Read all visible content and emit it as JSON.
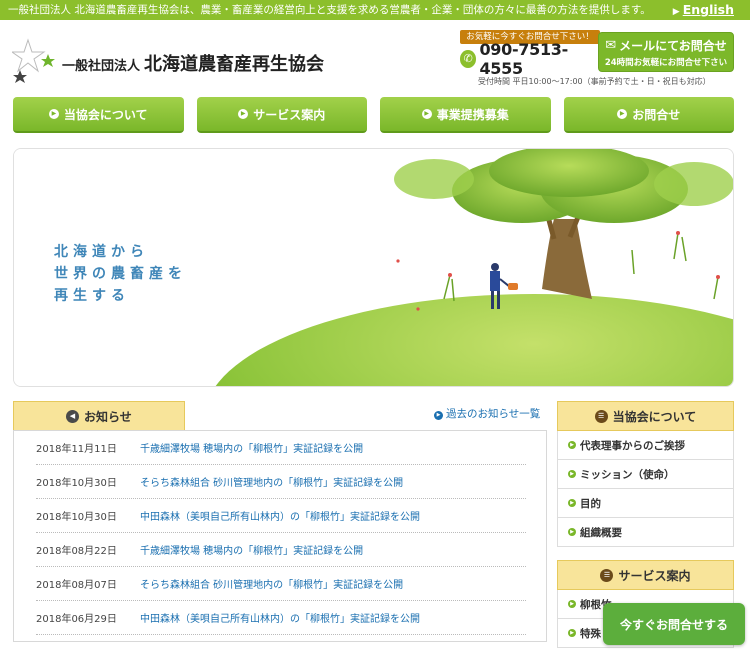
{
  "topbar": {
    "tagline": "一般社団法人 北海道農畜産再生協会は、農業・畜産業の経営向上と支援を求める営農者・企業・団体の方々に最善の方法を提供します。",
    "english_link": "English"
  },
  "header": {
    "org_type": "一般社団法人",
    "org_name": "北海道農畜産再生協会",
    "contact_tag": "お気軽に今すぐお問合せ下さい！",
    "phone": "090-7513-4555",
    "mail_button": "メールにてお問合せ",
    "mail_sub": "24時間お気軽にお問合せ下さい",
    "hours": "受付時間 平日10:00〜17:00（事前予約で土・日・祝日も対応）"
  },
  "nav": {
    "items": [
      {
        "label": "当協会について"
      },
      {
        "label": "サービス案内"
      },
      {
        "label": "事業提携募集"
      },
      {
        "label": "お問合せ"
      }
    ]
  },
  "hero": {
    "lines": [
      "北海道から",
      "世界の農畜産を",
      "再生する"
    ]
  },
  "news": {
    "heading": "お知らせ",
    "past_link": "過去のお知らせ一覧",
    "items": [
      {
        "date": "2018年11月11日",
        "title": "千歳細澤牧場 穂場内の「柳根竹」実証記録を公開"
      },
      {
        "date": "2018年10月30日",
        "title": "そらち森林組合 砂川管理地内の「柳根竹」実証記録を公開"
      },
      {
        "date": "2018年10月30日",
        "title": "中田森林（美唄自己所有山林内）の「柳根竹」実証記録を公開"
      },
      {
        "date": "2018年08月22日",
        "title": "千歳細澤牧場 穂場内の「柳根竹」実証記録を公開"
      },
      {
        "date": "2018年08月07日",
        "title": "そらち森林組合 砂川管理地内の「柳根竹」実証記録を公開"
      },
      {
        "date": "2018年06月29日",
        "title": "中田森林（美唄自己所有山林内）の「柳根竹」実証記録を公開"
      }
    ]
  },
  "sidebar": {
    "about_heading": "当協会について",
    "about_items": [
      {
        "label": "代表理事からのご挨拶"
      },
      {
        "label": "ミッション（使命）"
      },
      {
        "label": "目的"
      },
      {
        "label": "組織概要"
      }
    ],
    "service_heading": "サービス案内",
    "service_items": [
      {
        "label": "柳根竹"
      },
      {
        "label": "特殊"
      }
    ]
  },
  "cta": {
    "label": "今すぐお問合せする"
  },
  "colors": {
    "brand_green": "#7ab72a",
    "topbar_green": "#8cbf2c",
    "link_blue": "#1a6fb0",
    "tab_yellow": "#f8e49a",
    "hero_text_blue": "#3f86b8"
  }
}
